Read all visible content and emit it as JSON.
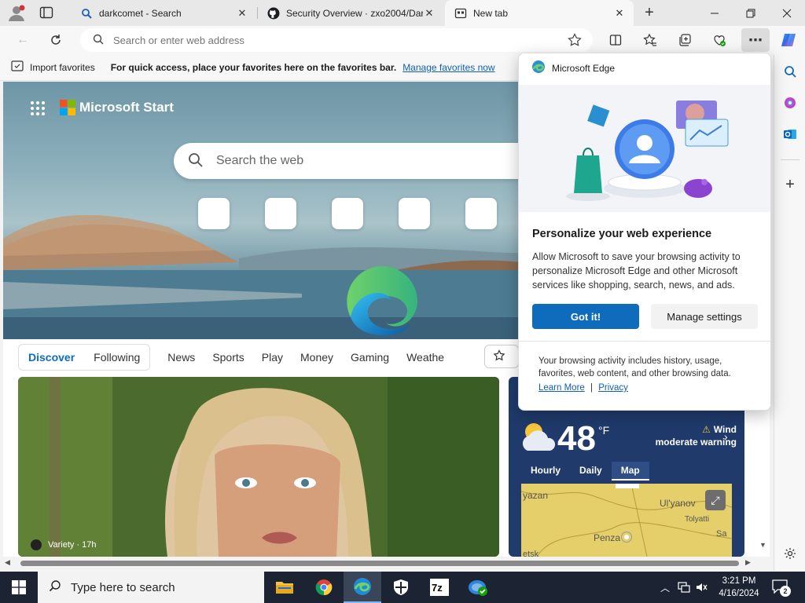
{
  "tabs": [
    {
      "label": "darkcomet - Search",
      "icon": "search-icon"
    },
    {
      "label": "Security Overview · zxo2004/Dar",
      "icon": "github-icon"
    },
    {
      "label": "New tab",
      "icon": "newtab-icon",
      "active": true
    }
  ],
  "address": {
    "placeholder": "Search or enter web address"
  },
  "favorites_bar": {
    "import_label": "Import favorites",
    "message": "For quick access, place your favorites here on the favorites bar.",
    "manage_link": "Manage favorites now"
  },
  "ntp": {
    "brand": "Microsoft Start",
    "search_placeholder": "Search the web",
    "feed_tabs": [
      "Discover",
      "Following"
    ],
    "categories": [
      "News",
      "Sports",
      "Play",
      "Money",
      "Gaming",
      "Weathe"
    ],
    "photo_card": {
      "source": "Variety",
      "age": "17h"
    },
    "weather": {
      "temperature": "48",
      "unit": "°F",
      "alert_title": "Wind",
      "alert_subtitle": "moderate warning",
      "tabs": [
        "Hourly",
        "Daily",
        "Map"
      ],
      "selected_tab": "Map",
      "map_labels": [
        "yazan",
        "Ul'yanov",
        "Tolyatti",
        "Penza",
        "Sa",
        "etsk"
      ]
    }
  },
  "popup": {
    "app_name": "Microsoft Edge",
    "title": "Personalize your web experience",
    "body": "Allow Microsoft to save your browsing activity to personalize Microsoft Edge and other Microsoft services like shopping, search, news, and ads.",
    "primary_button": "Got it!",
    "secondary_button": "Manage settings",
    "footer": "Your browsing activity includes history, usage, favorites, web content, and other browsing data.",
    "learn_more": "Learn More",
    "separator": "|",
    "privacy": "Privacy"
  },
  "taskbar": {
    "search_placeholder": "Type here to search",
    "time": "3:21 PM",
    "date": "4/16/2024",
    "notification_count": "2"
  },
  "colors": {
    "accent": "#0f6cbd",
    "taskbar": "#1c2433"
  }
}
